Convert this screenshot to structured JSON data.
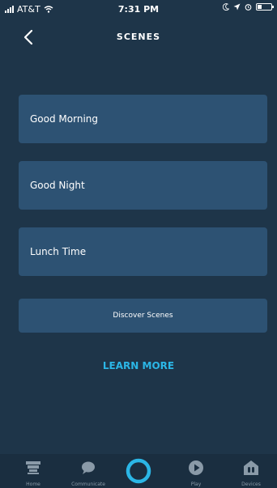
{
  "status_bar": {
    "carrier": "AT&T",
    "time": "7:31 PM",
    "battery_level": 0.3
  },
  "header": {
    "title": "SCENES",
    "back_icon": "chevron-left-icon"
  },
  "scenes": [
    {
      "label": "Good Morning"
    },
    {
      "label": "Good Night"
    },
    {
      "label": "Lunch Time"
    }
  ],
  "discover_label": "Discover Scenes",
  "learn_more_label": "LEARN MORE",
  "bottom_nav": {
    "items": [
      {
        "label": "Home",
        "icon": "home-icon"
      },
      {
        "label": "Communicate",
        "icon": "chat-bubble-icon"
      },
      {
        "label": "",
        "icon": "alexa-ring-icon"
      },
      {
        "label": "Play",
        "icon": "play-icon"
      },
      {
        "label": "Devices",
        "icon": "devices-icon"
      }
    ]
  },
  "colors": {
    "background": "#1e3549",
    "card": "#2d5273",
    "accent": "#2bb6e6",
    "nav_background": "#1a2e40",
    "nav_label": "#8a9aa8"
  }
}
